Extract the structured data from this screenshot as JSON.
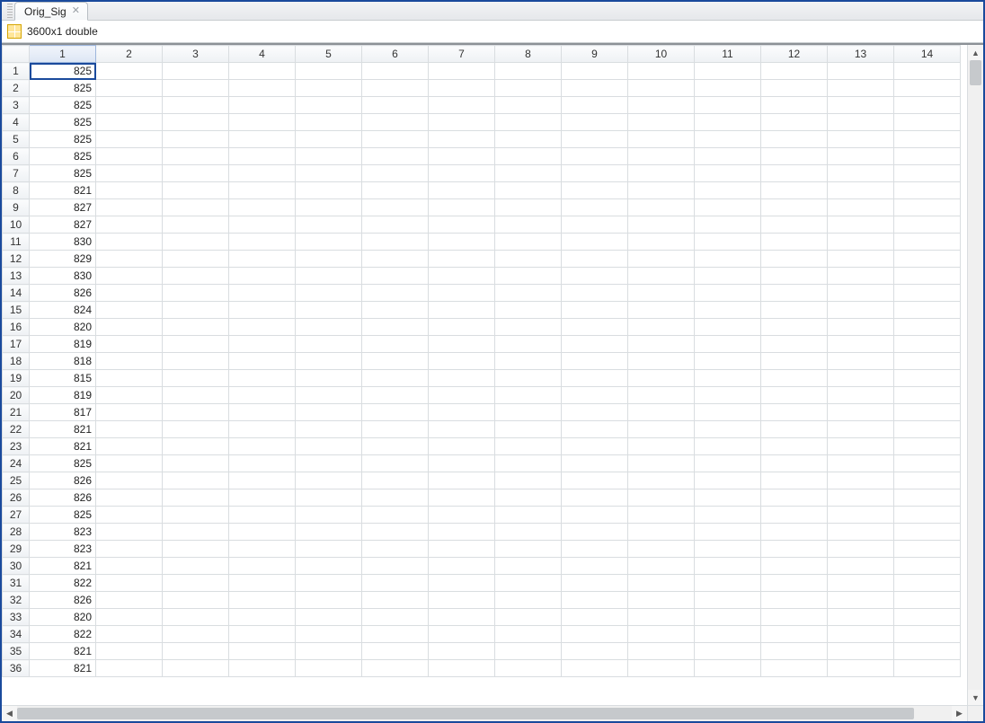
{
  "tab": {
    "label": "Orig_Sig",
    "close_glyph": "✕"
  },
  "infobar": {
    "text": "3600x1 double"
  },
  "grid": {
    "num_columns": 14,
    "selected_cell": {
      "row": 1,
      "col": 1
    },
    "column_headers": [
      "1",
      "2",
      "3",
      "4",
      "5",
      "6",
      "7",
      "8",
      "9",
      "10",
      "11",
      "12",
      "13",
      "14"
    ],
    "rows": [
      {
        "idx": "1",
        "c1": "825"
      },
      {
        "idx": "2",
        "c1": "825"
      },
      {
        "idx": "3",
        "c1": "825"
      },
      {
        "idx": "4",
        "c1": "825"
      },
      {
        "idx": "5",
        "c1": "825"
      },
      {
        "idx": "6",
        "c1": "825"
      },
      {
        "idx": "7",
        "c1": "825"
      },
      {
        "idx": "8",
        "c1": "821"
      },
      {
        "idx": "9",
        "c1": "827"
      },
      {
        "idx": "10",
        "c1": "827"
      },
      {
        "idx": "11",
        "c1": "830"
      },
      {
        "idx": "12",
        "c1": "829"
      },
      {
        "idx": "13",
        "c1": "830"
      },
      {
        "idx": "14",
        "c1": "826"
      },
      {
        "idx": "15",
        "c1": "824"
      },
      {
        "idx": "16",
        "c1": "820"
      },
      {
        "idx": "17",
        "c1": "819"
      },
      {
        "idx": "18",
        "c1": "818"
      },
      {
        "idx": "19",
        "c1": "815"
      },
      {
        "idx": "20",
        "c1": "819"
      },
      {
        "idx": "21",
        "c1": "817"
      },
      {
        "idx": "22",
        "c1": "821"
      },
      {
        "idx": "23",
        "c1": "821"
      },
      {
        "idx": "24",
        "c1": "825"
      },
      {
        "idx": "25",
        "c1": "826"
      },
      {
        "idx": "26",
        "c1": "826"
      },
      {
        "idx": "27",
        "c1": "825"
      },
      {
        "idx": "28",
        "c1": "823"
      },
      {
        "idx": "29",
        "c1": "823"
      },
      {
        "idx": "30",
        "c1": "821"
      },
      {
        "idx": "31",
        "c1": "822"
      },
      {
        "idx": "32",
        "c1": "826"
      },
      {
        "idx": "33",
        "c1": "820"
      },
      {
        "idx": "34",
        "c1": "822"
      },
      {
        "idx": "35",
        "c1": "821"
      },
      {
        "idx": "36",
        "c1": "821"
      }
    ]
  },
  "scroll": {
    "up_glyph": "▲",
    "down_glyph": "▼",
    "left_glyph": "◀",
    "right_glyph": "▶"
  }
}
